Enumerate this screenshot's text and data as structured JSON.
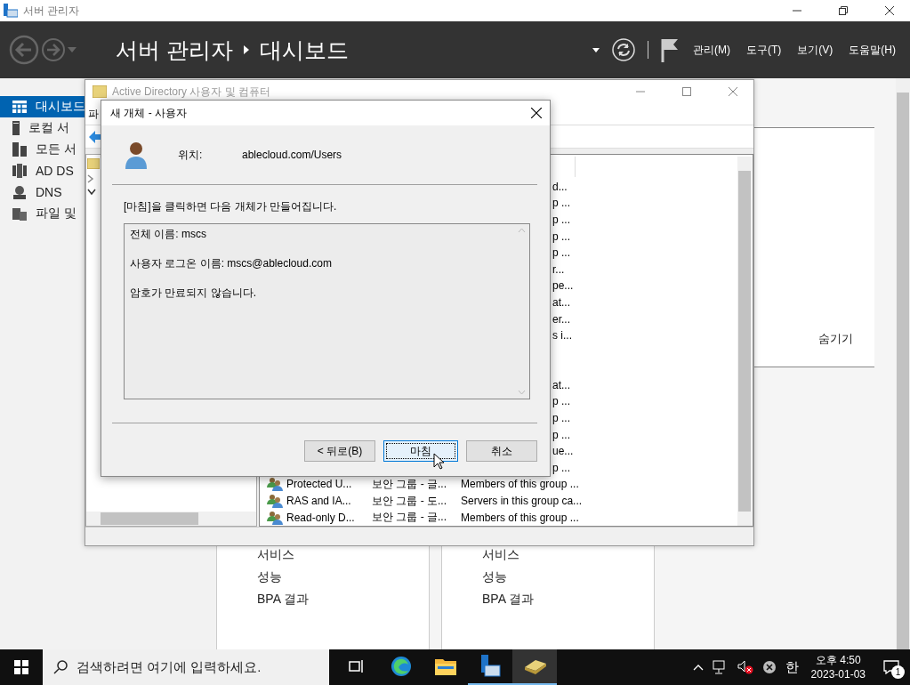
{
  "server_manager": {
    "title": "서버 관리자",
    "breadcrumb": [
      "서버 관리자",
      "대시보드"
    ],
    "menus": [
      "관리(M)",
      "도구(T)",
      "보기(V)",
      "도움말(H)"
    ],
    "sidebar": [
      {
        "label": "대시보드",
        "selected": true
      },
      {
        "label": "로컬 서",
        "selected": false
      },
      {
        "label": "모든 서",
        "selected": false
      },
      {
        "label": "AD DS",
        "selected": false
      },
      {
        "label": "DNS",
        "selected": false
      },
      {
        "label": "파일 및",
        "selected": false
      }
    ],
    "hide_link": "숨기기",
    "tiles": [
      {
        "items": [
          "서비스",
          "성능",
          "BPA 결과"
        ]
      },
      {
        "items": [
          "서비스",
          "성능",
          "BPA 결과"
        ]
      }
    ]
  },
  "ad_window": {
    "title": "Active Directory 사용자 및 컴퓨터",
    "menu": [
      "파"
    ],
    "fragments_top": [
      "d...",
      "p ...",
      "p ...",
      "p ...",
      "p ...",
      "r...",
      "pe...",
      "at...",
      "er...",
      "s i..."
    ],
    "fragments_bottom": [
      "at...",
      "p ...",
      "p ...",
      "p ...",
      "ue...",
      "p ..."
    ],
    "rows": [
      {
        "name": "Protected U...",
        "type": "보안 그룹 - 글...",
        "description": "Members of this group ..."
      },
      {
        "name": "RAS and IA...",
        "type": "보안 그룹 - 도...",
        "description": "Servers in this group ca..."
      },
      {
        "name": "Read-only D...",
        "type": "보안 그룹 - 글...",
        "description": "Members of this group ..."
      }
    ]
  },
  "dialog": {
    "title": "새 개체 - 사용자",
    "location_label": "위치:",
    "location": "ablecloud.com/Users",
    "instruction": "[마침]을 클릭하면 다음 개체가 만들어집니다.",
    "summary": [
      "전체 이름: mscs",
      "사용자 로그온 이름: mscs@ablecloud.com",
      "암호가 만료되지 않습니다."
    ],
    "buttons": [
      {
        "label": "< 뒤로(B)",
        "focused": false
      },
      {
        "label": "마침",
        "focused": true
      },
      {
        "label": "취소",
        "focused": false
      }
    ]
  },
  "taskbar": {
    "search_placeholder": "검색하려면 여기에 입력하세요.",
    "apps": [
      {
        "running": false,
        "selected": false
      },
      {
        "running": false,
        "selected": false
      },
      {
        "running": true,
        "selected": false
      },
      {
        "running": true,
        "selected": true
      }
    ],
    "ime": "한",
    "time": "오후 4:50",
    "date": "2023-01-03",
    "notifications": "1"
  }
}
